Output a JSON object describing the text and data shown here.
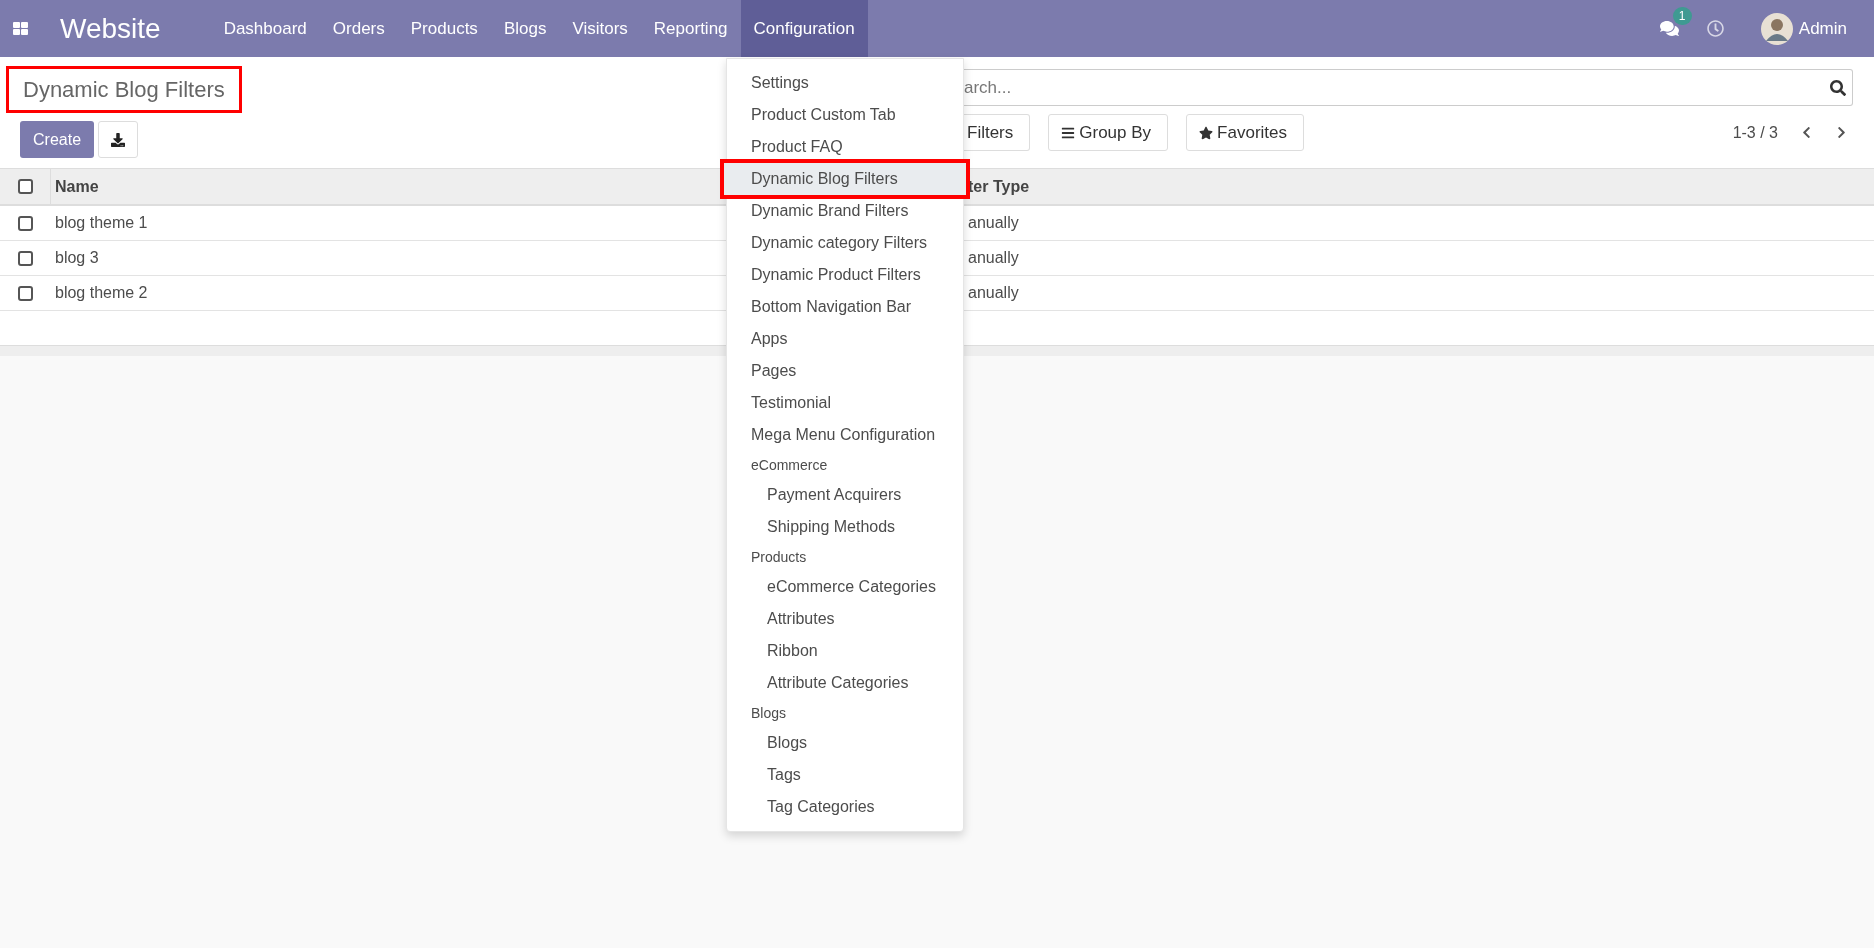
{
  "top_bar": {
    "app_name": "Website",
    "nav": [
      {
        "label": "Dashboard",
        "selected": false
      },
      {
        "label": "Orders",
        "selected": false
      },
      {
        "label": "Products",
        "selected": false
      },
      {
        "label": "Blogs",
        "selected": false
      },
      {
        "label": "Visitors",
        "selected": false
      },
      {
        "label": "Reporting",
        "selected": false
      },
      {
        "label": "Configuration",
        "selected": true
      }
    ],
    "messages_badge": "1",
    "user": "Admin"
  },
  "breadcrumb": {
    "title": "Dynamic Blog Filters",
    "highlighted": true
  },
  "buttons": {
    "create": "Create"
  },
  "search": {
    "placeholder": "arch..."
  },
  "filters": [
    {
      "label": "Filters",
      "kind": "filter"
    },
    {
      "label": "Group By",
      "kind": "group"
    },
    {
      "label": "Favorites",
      "kind": "favorite"
    }
  ],
  "pager": "1-3 / 3",
  "table": {
    "all_checked": false,
    "columns": [
      "Name",
      "ter Type"
    ],
    "rows": [
      {
        "checked": false,
        "cells": [
          "blog theme 1",
          "anually"
        ]
      },
      {
        "checked": false,
        "cells": [
          "blog 3",
          "anually"
        ]
      },
      {
        "checked": false,
        "cells": [
          "blog theme 2",
          "anually"
        ]
      }
    ]
  },
  "menu": [
    {
      "kind": "item",
      "label": "Settings",
      "highlighted": false
    },
    {
      "kind": "item",
      "label": "Product Custom Tab",
      "highlighted": false
    },
    {
      "kind": "item",
      "label": "Product FAQ",
      "highlighted": false
    },
    {
      "kind": "item",
      "label": "Dynamic Blog Filters",
      "highlighted": true
    },
    {
      "kind": "item",
      "label": "Dynamic Brand Filters",
      "highlighted": false
    },
    {
      "kind": "item",
      "label": "Dynamic category Filters",
      "highlighted": false
    },
    {
      "kind": "item",
      "label": "Dynamic Product Filters",
      "highlighted": false
    },
    {
      "kind": "item",
      "label": "Bottom Navigation Bar",
      "highlighted": false
    },
    {
      "kind": "item",
      "label": "Apps",
      "highlighted": false
    },
    {
      "kind": "item",
      "label": "Pages",
      "highlighted": false
    },
    {
      "kind": "item",
      "label": "Testimonial",
      "highlighted": false
    },
    {
      "kind": "item",
      "label": "Mega Menu Configuration",
      "highlighted": false
    },
    {
      "kind": "header",
      "label": "eCommerce",
      "children": [
        {
          "label": "Payment Acquirers"
        },
        {
          "label": "Shipping Methods"
        }
      ]
    },
    {
      "kind": "header",
      "label": "Products",
      "children": [
        {
          "label": "eCommerce Categories"
        },
        {
          "label": "Attributes"
        },
        {
          "label": "Ribbon"
        },
        {
          "label": "Attribute Categories"
        }
      ]
    },
    {
      "kind": "header",
      "label": "Blogs",
      "children": [
        {
          "label": "Blogs"
        },
        {
          "label": "Tags"
        },
        {
          "label": "Tag Categories"
        }
      ]
    }
  ]
}
